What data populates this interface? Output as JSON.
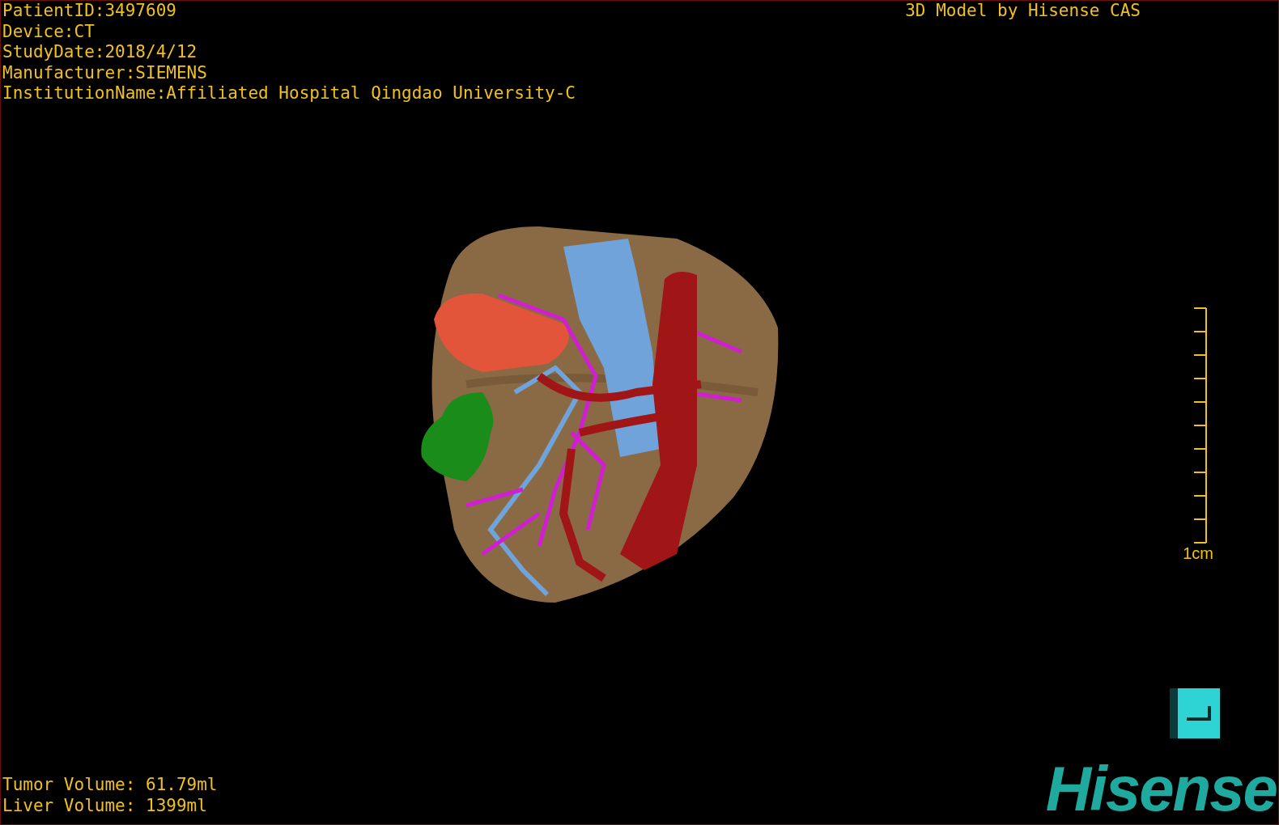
{
  "study_info": [
    "PatientID:3497609",
    "Device:CT",
    "StudyDate:2018/4/12",
    "Manufacturer:SIEMENS",
    "InstitutionName:Affiliated Hospital Qingdao University-C"
  ],
  "model_credit": "3D Model by Hisense CAS",
  "scale_bar": {
    "label": "1cm"
  },
  "volumes": [
    "Tumor Volume: 61.79ml",
    "Liver Volume: 1399ml"
  ],
  "logo": "Hisense"
}
